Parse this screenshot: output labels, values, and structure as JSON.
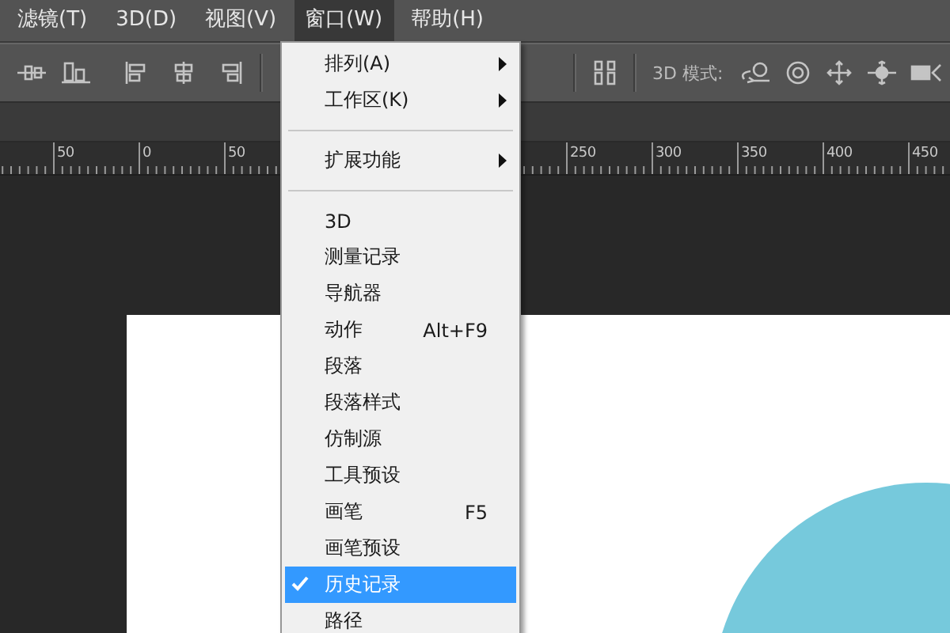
{
  "menubar": [
    {
      "label": "滤镜(T)",
      "selected": false
    },
    {
      "label": "3D(D)",
      "selected": false
    },
    {
      "label": "视图(V)",
      "selected": false
    },
    {
      "label": "窗口(W)",
      "selected": true
    },
    {
      "label": "帮助(H)",
      "selected": false
    }
  ],
  "options_bar": {
    "mode_label": "3D 模式:"
  },
  "ruler": {
    "labels": [
      {
        "text": "50"
      },
      {
        "text": "0"
      },
      {
        "text": "50"
      },
      {
        "text": "250"
      },
      {
        "text": "300"
      },
      {
        "text": "350"
      },
      {
        "text": "400"
      },
      {
        "text": "450"
      }
    ]
  },
  "window_menu": {
    "items": [
      {
        "kind": "submenu",
        "label": "排列(A)",
        "checked": false,
        "selected": false
      },
      {
        "kind": "submenu",
        "label": "工作区(K)",
        "checked": false,
        "selected": false
      },
      {
        "kind": "separator"
      },
      {
        "kind": "submenu",
        "label": "扩展功能",
        "checked": false,
        "selected": false
      },
      {
        "kind": "separator"
      },
      {
        "kind": "item",
        "label": "3D",
        "checked": false,
        "selected": false
      },
      {
        "kind": "item",
        "label": "测量记录",
        "checked": false,
        "selected": false
      },
      {
        "kind": "item",
        "label": "导航器",
        "checked": false,
        "selected": false
      },
      {
        "kind": "item",
        "label": "动作",
        "shortcut": "Alt+F9",
        "checked": false,
        "selected": false
      },
      {
        "kind": "item",
        "label": "段落",
        "checked": false,
        "selected": false
      },
      {
        "kind": "item",
        "label": "段落样式",
        "checked": false,
        "selected": false
      },
      {
        "kind": "item",
        "label": "仿制源",
        "checked": false,
        "selected": false
      },
      {
        "kind": "item",
        "label": "工具预设",
        "checked": false,
        "selected": false
      },
      {
        "kind": "item",
        "label": "画笔",
        "shortcut": "F5",
        "checked": false,
        "selected": false
      },
      {
        "kind": "item",
        "label": "画笔预设",
        "checked": false,
        "selected": false
      },
      {
        "kind": "item",
        "label": "历史记录",
        "checked": true,
        "selected": true
      },
      {
        "kind": "item",
        "label": "路径",
        "checked": false,
        "selected": false
      }
    ]
  }
}
